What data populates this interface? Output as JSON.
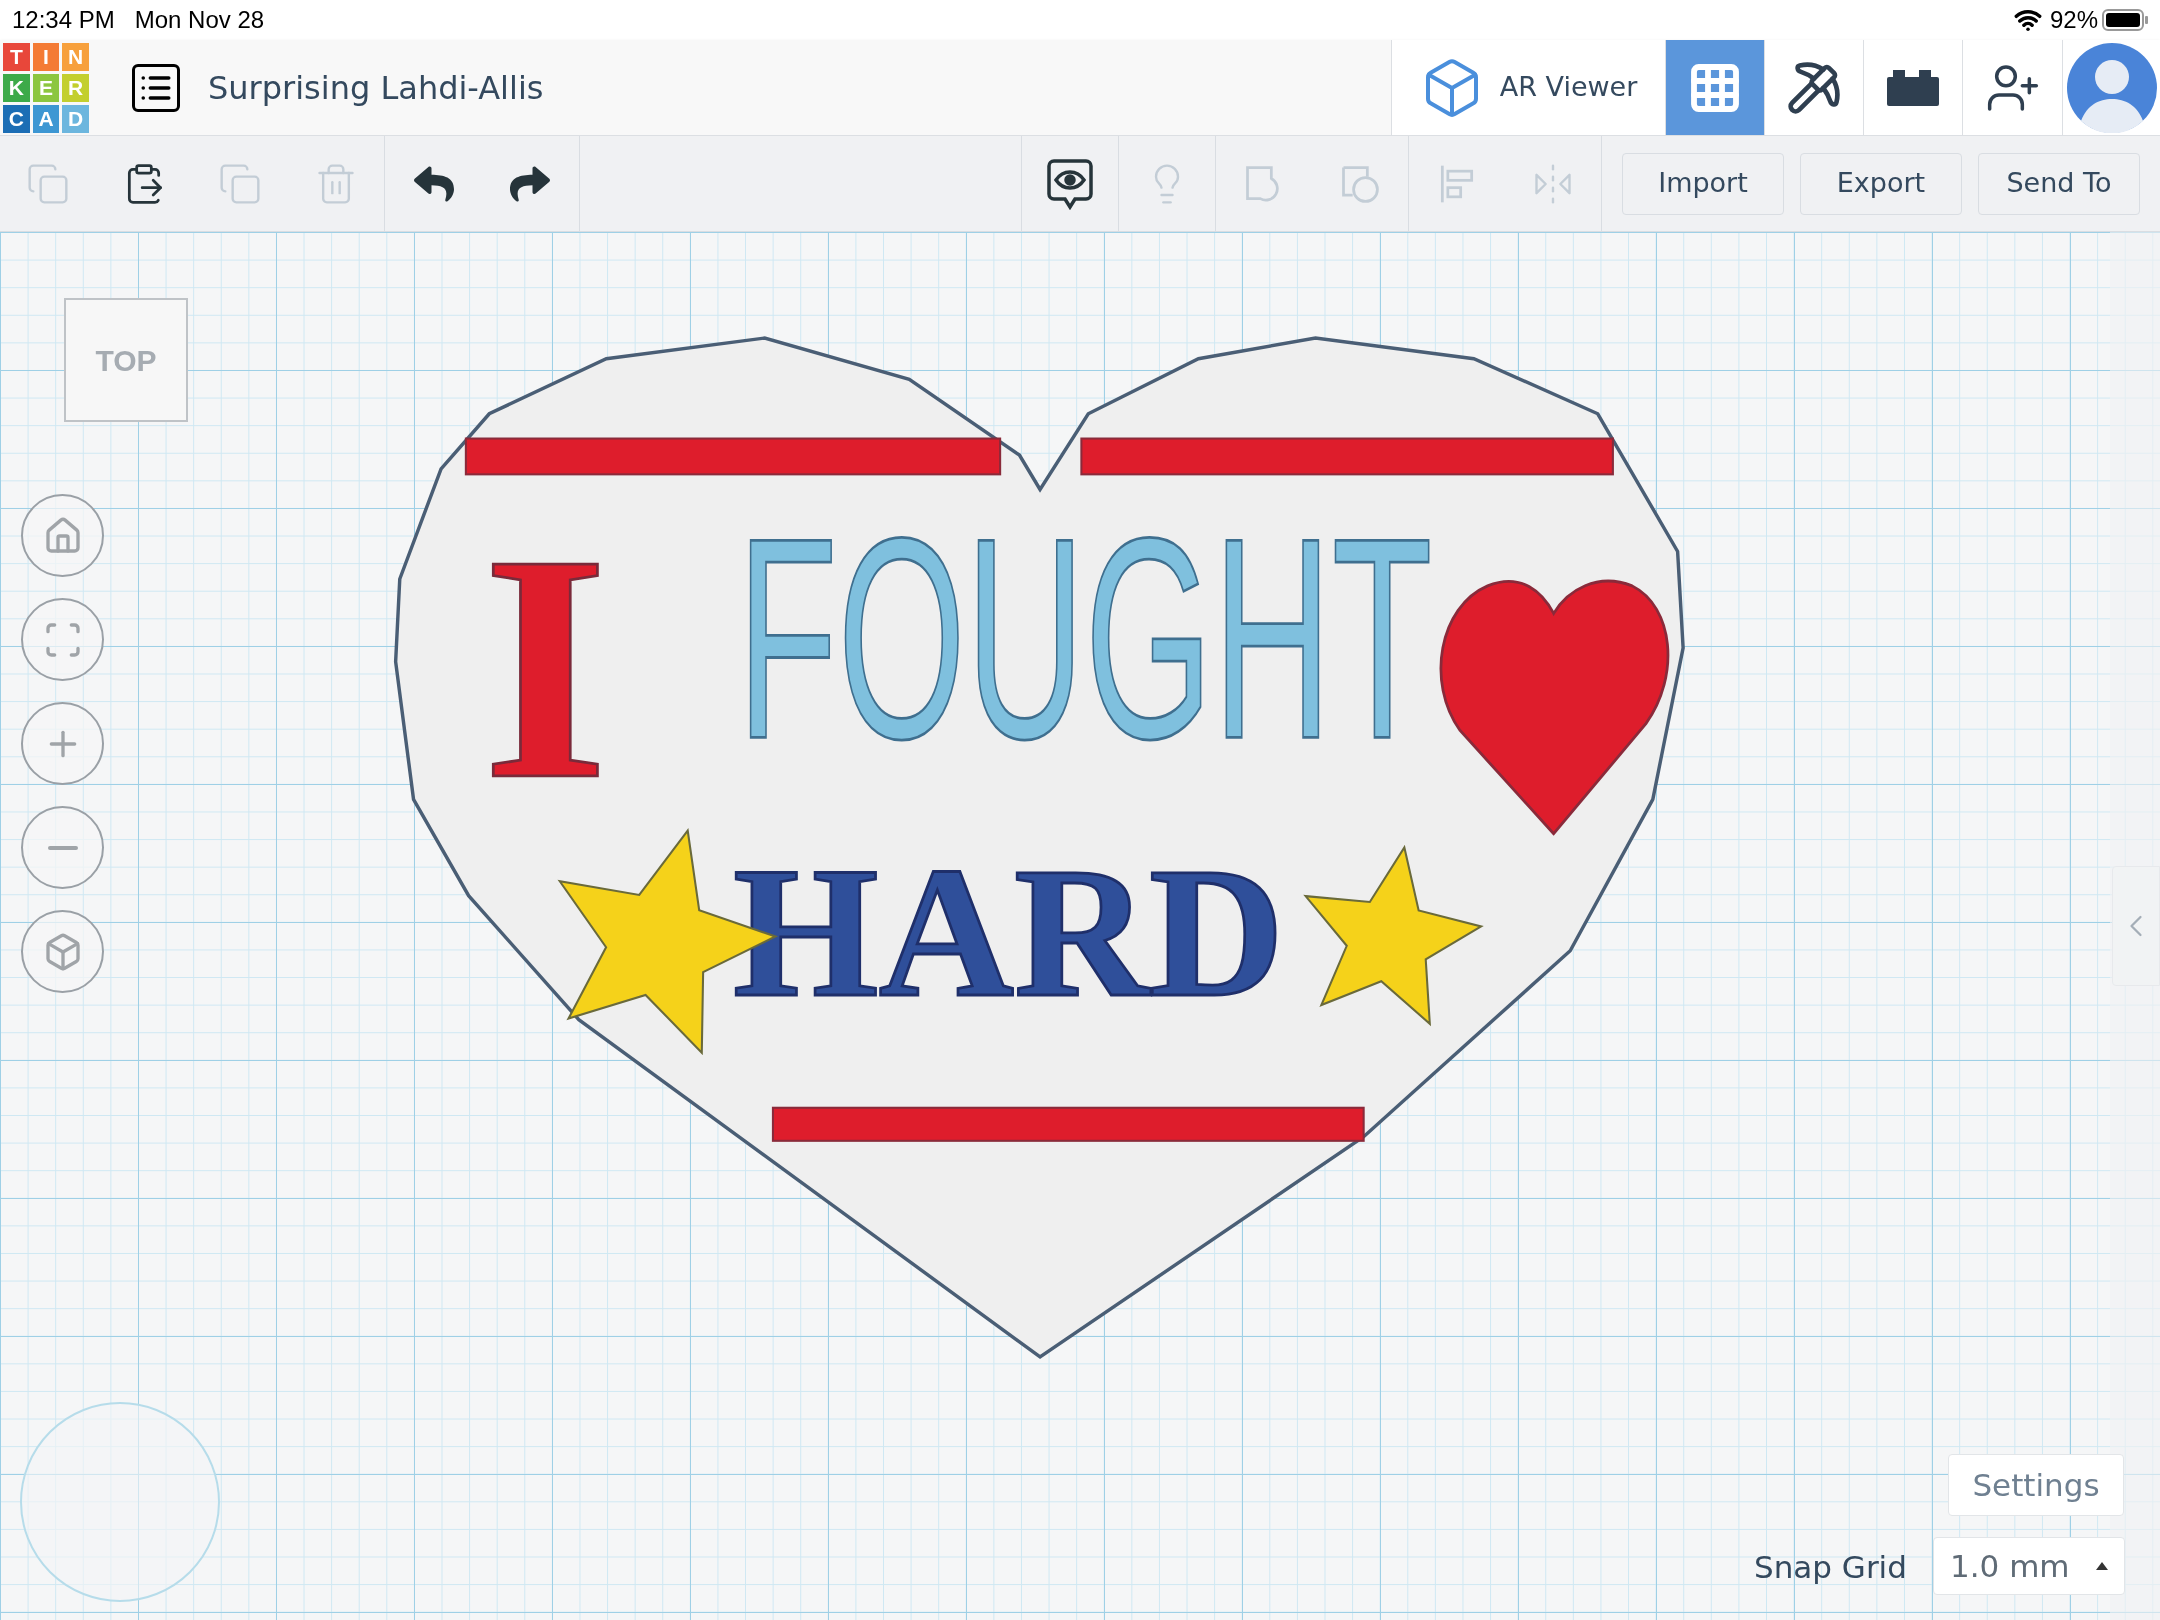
{
  "status_bar": {
    "time": "12:34 PM",
    "date": "Mon Nov 28",
    "battery": "92%"
  },
  "logo": [
    {
      "letter": "T",
      "color": "#e8473a"
    },
    {
      "letter": "I",
      "color": "#f47b35"
    },
    {
      "letter": "N",
      "color": "#f7a03c"
    },
    {
      "letter": "K",
      "color": "#3daa49"
    },
    {
      "letter": "E",
      "color": "#8cc63f"
    },
    {
      "letter": "R",
      "color": "#c3cf2e"
    },
    {
      "letter": "C",
      "color": "#1c6eb5"
    },
    {
      "letter": "A",
      "color": "#3d97d3"
    },
    {
      "letter": "D",
      "color": "#6cb6de"
    }
  ],
  "header": {
    "title": "Surprising Lahdi-Allis",
    "ar_viewer": "AR Viewer",
    "modes": [
      {
        "kind": "grid",
        "selected": true
      },
      {
        "kind": "pickaxe",
        "selected": false
      },
      {
        "kind": "brick",
        "selected": false
      }
    ]
  },
  "toolbar": {
    "tools": [
      {
        "kind": "copy",
        "disabled": true
      },
      {
        "kind": "paste",
        "disabled": false
      },
      {
        "kind": "duplicate",
        "disabled": true
      },
      {
        "kind": "delete",
        "disabled": true
      },
      {
        "kind": "undo",
        "disabled": false
      },
      {
        "kind": "redo",
        "disabled": false
      },
      {
        "kind": "notes",
        "disabled": false
      },
      {
        "kind": "bulb",
        "disabled": true
      },
      {
        "kind": "group",
        "disabled": true
      },
      {
        "kind": "ungroup",
        "disabled": true
      },
      {
        "kind": "align",
        "disabled": true
      },
      {
        "kind": "mirror",
        "disabled": true
      }
    ],
    "buttons": [
      "Import",
      "Export",
      "Send To"
    ]
  },
  "canvas": {
    "view_cube": "TOP",
    "design_texts": [
      "I",
      "FOUGHT",
      "HARD"
    ],
    "settings": "Settings",
    "snap_grid": {
      "label": "Snap Grid",
      "value": "1.0 mm"
    }
  }
}
